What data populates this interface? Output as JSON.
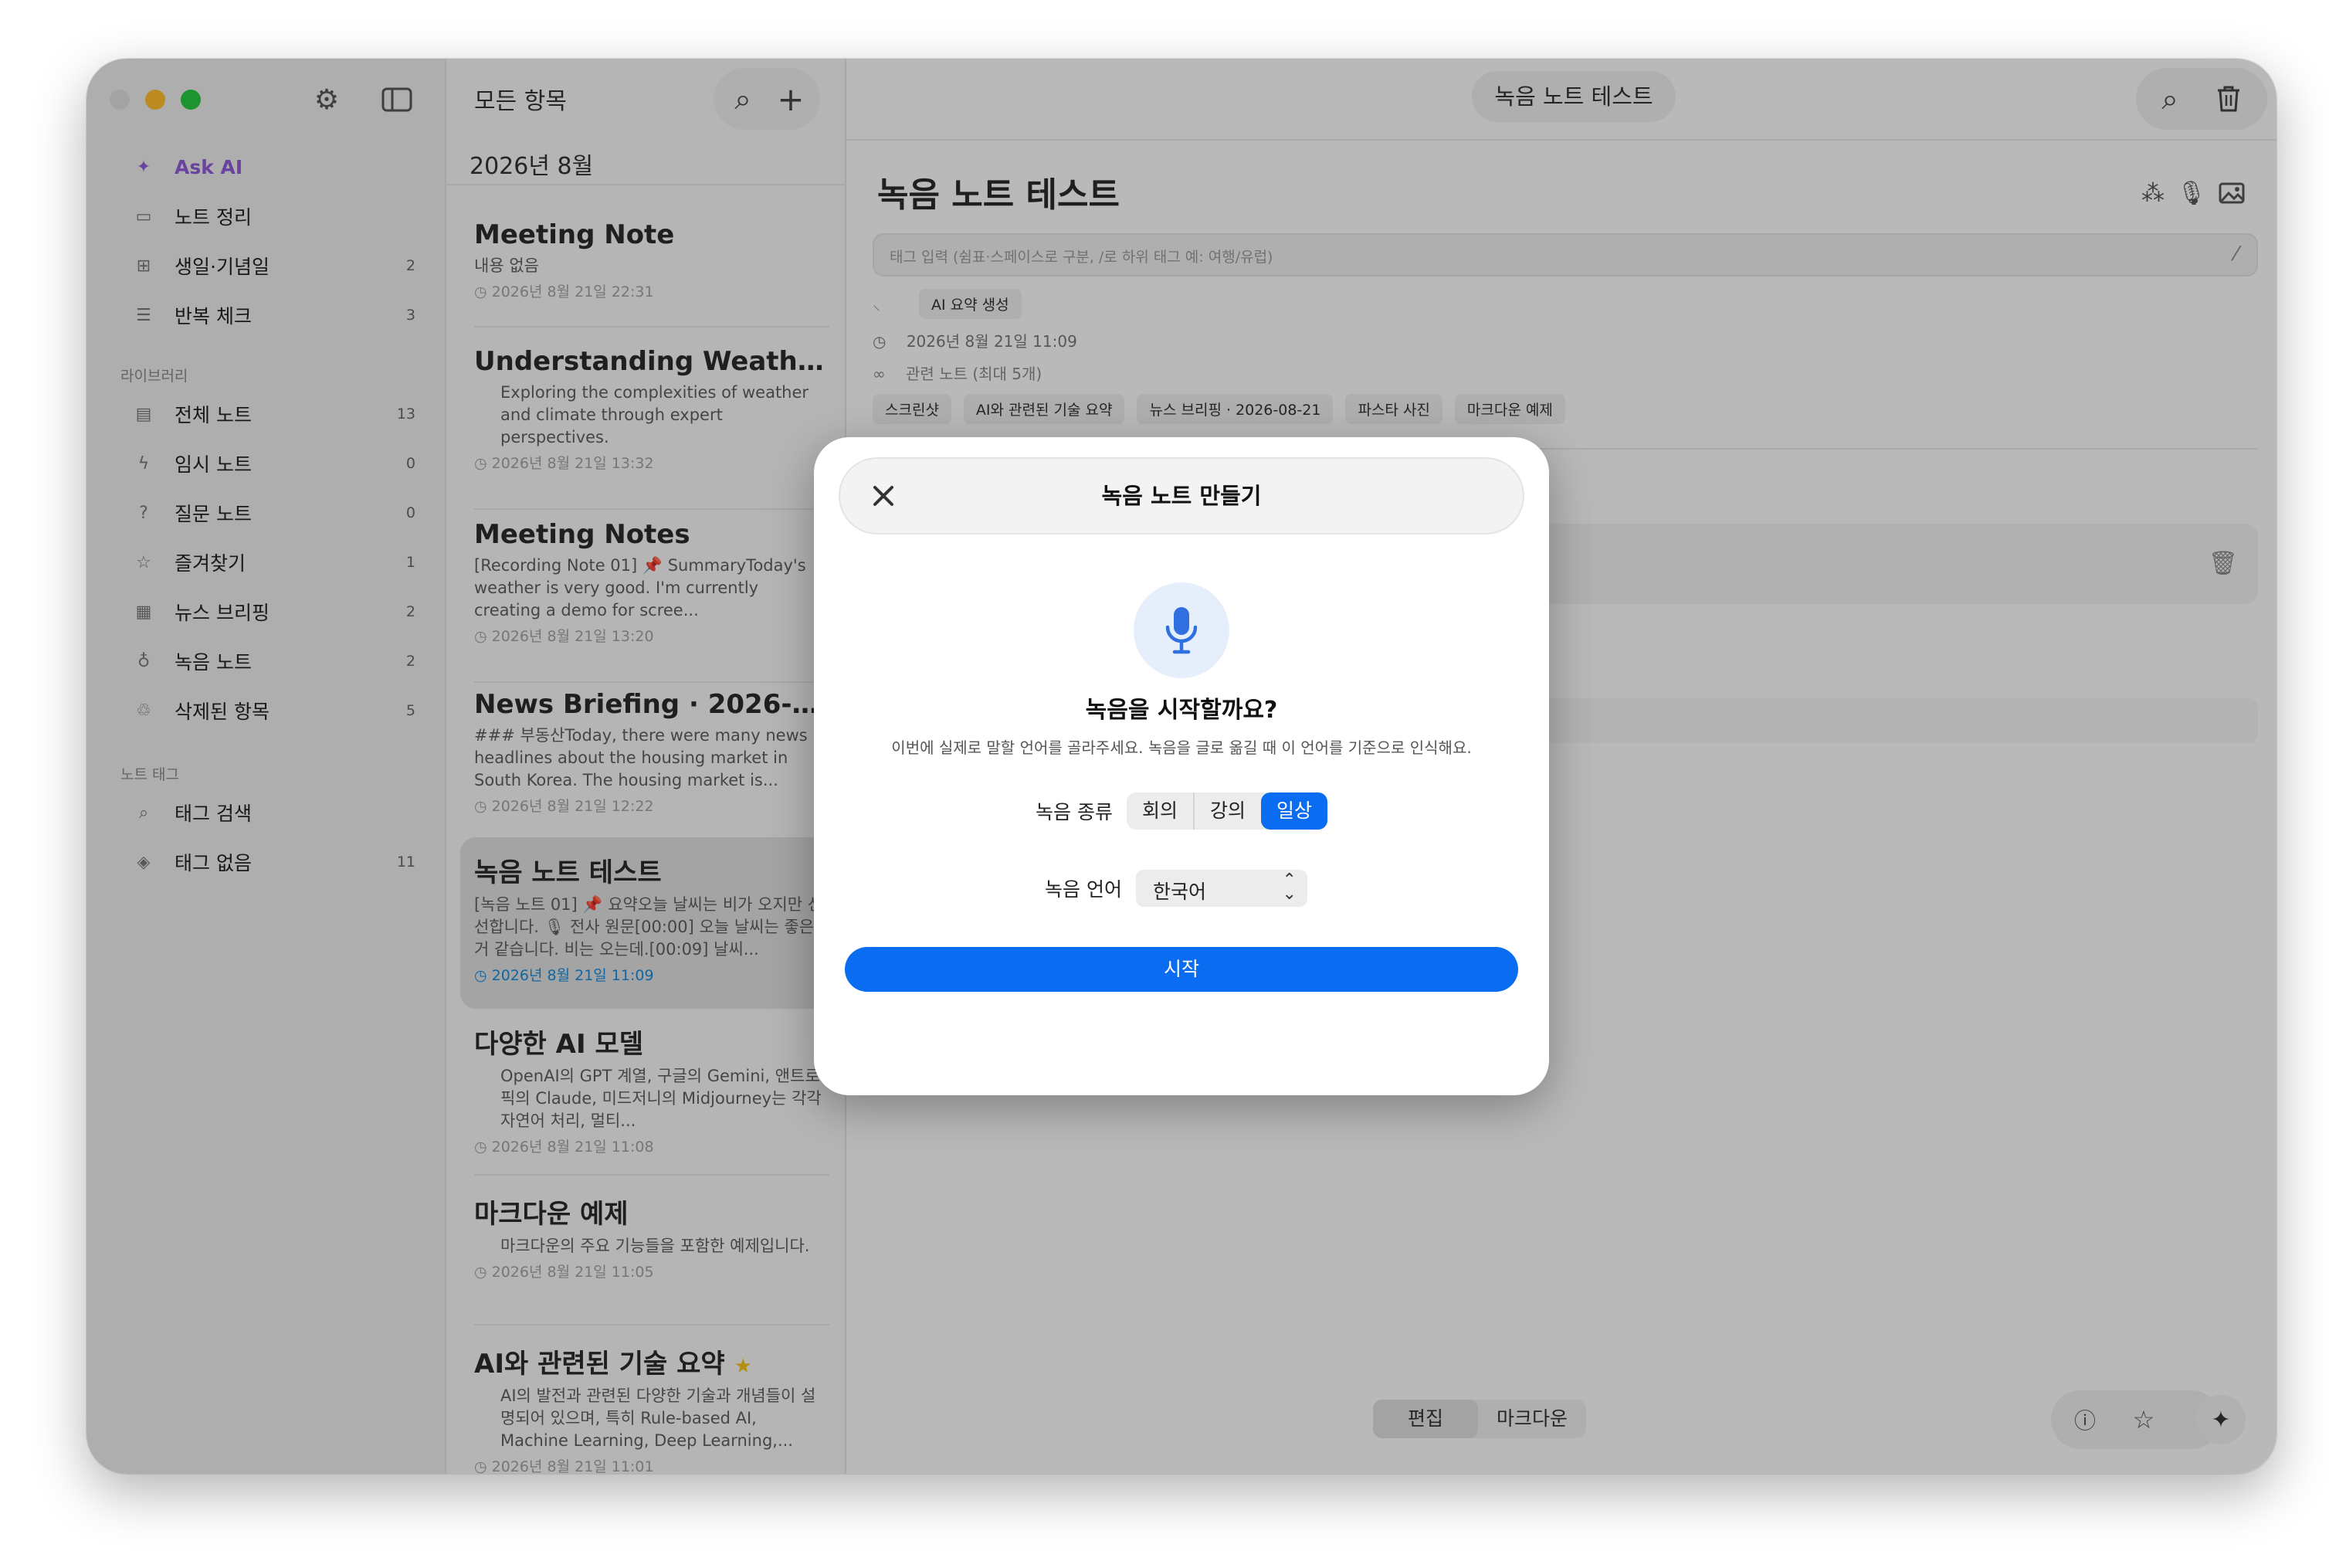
{
  "sidebar": {
    "items": [
      {
        "icon": "sparkle-icon",
        "label": "Ask AI",
        "count": ""
      },
      {
        "icon": "inbox-icon",
        "label": "노트 정리",
        "count": ""
      },
      {
        "icon": "gift-icon",
        "label": "생일·기념일",
        "count": "2"
      },
      {
        "icon": "checklist-icon",
        "label": "반복 체크",
        "count": "3"
      }
    ],
    "library_header": "라이브러리",
    "library": [
      {
        "icon": "document-icon",
        "label": "전체 노트",
        "count": "13"
      },
      {
        "icon": "bolt-icon",
        "label": "임시 노트",
        "count": "0"
      },
      {
        "icon": "question-icon",
        "label": "질문 노트",
        "count": "0"
      },
      {
        "icon": "star-icon",
        "label": "즐겨찾기",
        "count": "1"
      },
      {
        "icon": "newspaper-icon",
        "label": "뉴스 브리핑",
        "count": "2"
      },
      {
        "icon": "mic-icon",
        "label": "녹음 노트",
        "count": "2"
      },
      {
        "icon": "trash-icon",
        "label": "삭제된 항목",
        "count": "5"
      }
    ],
    "tag_header": "노트 태그",
    "tags": [
      {
        "icon": "search-icon",
        "label": "태그 검색",
        "count": ""
      },
      {
        "icon": "tag-icon",
        "label": "태그 없음",
        "count": "11"
      }
    ]
  },
  "list": {
    "title": "모든 항목",
    "month": "2026년 8월",
    "notes": [
      {
        "title": "Meeting Note",
        "preview": "내용 없음",
        "date": "2026년 8월 21일 22:31"
      },
      {
        "title": "Understanding Weather...",
        "preview": "Exploring the complexities of weather and climate through expert perspectives.",
        "date": "2026년 8월 21일 13:32"
      },
      {
        "title": "Meeting Notes",
        "preview": "[Recording Note 01] 📌 SummaryToday's weather is very good. I'm currently creating a demo for scree...",
        "date": "2026년 8월 21일 13:20"
      },
      {
        "title": "News Briefing · 2026-0...",
        "preview": "### 부동산Today, there were many news headlines about the housing market in South Korea. The housing market is...",
        "date": "2026년 8월 21일 12:22"
      },
      {
        "title": "녹음 노트 테스트",
        "preview": "[녹음 노트 01] 📌 요약오늘 날씨는 비가 오지만 선선합니다. 🎙 전사 원문[00:00] 오늘 날씨는 좋은 거 같습니다. 비는 오는데.[00:09] 날씨...",
        "date": "2026년 8월 21일 11:09"
      },
      {
        "title": "다양한 AI 모델",
        "preview": "OpenAI의 GPT 계열, 구글의 Gemini, 앤트로픽의 Claude, 미드저니의 Midjourney는 각각 자연어 처리, 멀티...",
        "date": "2026년 8월 21일 11:08"
      },
      {
        "title": "마크다운 예제",
        "preview": "마크다운의 주요 기능들을 포함한 예제입니다.",
        "date": "2026년 8월 21일 11:05"
      },
      {
        "title": "AI와 관련된 기술 요약",
        "preview": "AI의 발전과 관련된 다양한 기술과 개념들이 설명되어 있으며, 특히 Rule-based AI, Machine Learning, Deep Learning,...",
        "date": "2026년 8월 21일 11:01"
      }
    ]
  },
  "detail": {
    "window_title": "녹음 노트 테스트",
    "title": "녹음 노트 테스트",
    "tag_placeholder": "태그 입력 (쉼표·스페이스로 구분, /로 하위 태그 예: 여행/유럽)",
    "ai_summary": "AI 요약 생성",
    "timestamp": "2026년 8월 21일 11:09",
    "related": "관련 노트 (최대 5개)",
    "related_chips": [
      "스크린샷",
      "AI와 관련된 기술 요약",
      "뉴스 브리핑 · 2026-08-21",
      "파스타 사진",
      "마크다운 예제"
    ],
    "mode_edit": "편집",
    "mode_markdown": "마크다운"
  },
  "modal": {
    "title": "녹음 노트 만들기",
    "question": "녹음을 시작할까요?",
    "description": "이번에 실제로 말할 언어를 골라주세요. 녹음을 글로 옮길 때 이 언어를 기준으로 인식해요.",
    "type_label": "녹음 종류",
    "type_options": [
      "회의",
      "강의",
      "일상"
    ],
    "selected_type": "일상",
    "lang_label": "녹음 언어",
    "lang_value": "한국어",
    "start": "시작"
  },
  "colors": {
    "accent": "#0a6cf0",
    "ask_ai": "#8e5bd6"
  }
}
